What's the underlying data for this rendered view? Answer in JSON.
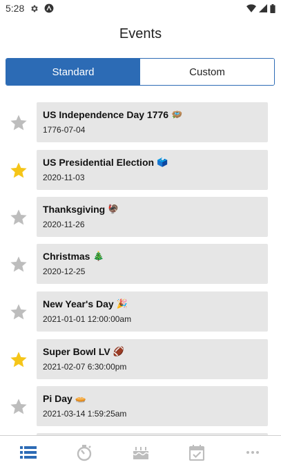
{
  "status_bar": {
    "time": "5:28"
  },
  "title": "Events",
  "tabs": [
    {
      "label": "Standard",
      "active": true
    },
    {
      "label": "Custom",
      "active": false
    }
  ],
  "events": [
    {
      "name": "US Independence Day 1776",
      "emoji": "🪺",
      "date": "1776-07-04",
      "favorite": false
    },
    {
      "name": "US Presidential Election",
      "emoji": "🗳️",
      "date": "2020-11-03",
      "favorite": true
    },
    {
      "name": "Thanksgiving",
      "emoji": "🦃",
      "date": "2020-11-26",
      "favorite": false
    },
    {
      "name": "Christmas",
      "emoji": "🎄",
      "date": "2020-12-25",
      "favorite": false
    },
    {
      "name": "New Year's Day",
      "emoji": "🎉",
      "date": "2021-01-01 12:00:00am",
      "favorite": false
    },
    {
      "name": "Super Bowl LV",
      "emoji": "🏈",
      "date": "2021-02-07 6:30:00pm",
      "favorite": true
    },
    {
      "name": "Pi Day",
      "emoji": "🥧",
      "date": "2021-03-14 1:59:25am",
      "favorite": false
    }
  ],
  "bottom_nav": [
    {
      "icon": "list-icon",
      "active": true
    },
    {
      "icon": "stopwatch-icon",
      "active": false
    },
    {
      "icon": "birthday-cake-icon",
      "active": false
    },
    {
      "icon": "calendar-check-icon",
      "active": false
    },
    {
      "icon": "more-dots-icon",
      "active": false
    }
  ],
  "colors": {
    "accent": "#2c6bb5",
    "star_on": "#f5c518",
    "star_off": "#bdbdbd",
    "card_bg": "#e6e6e6",
    "nav_inactive": "#bdbdbd"
  }
}
